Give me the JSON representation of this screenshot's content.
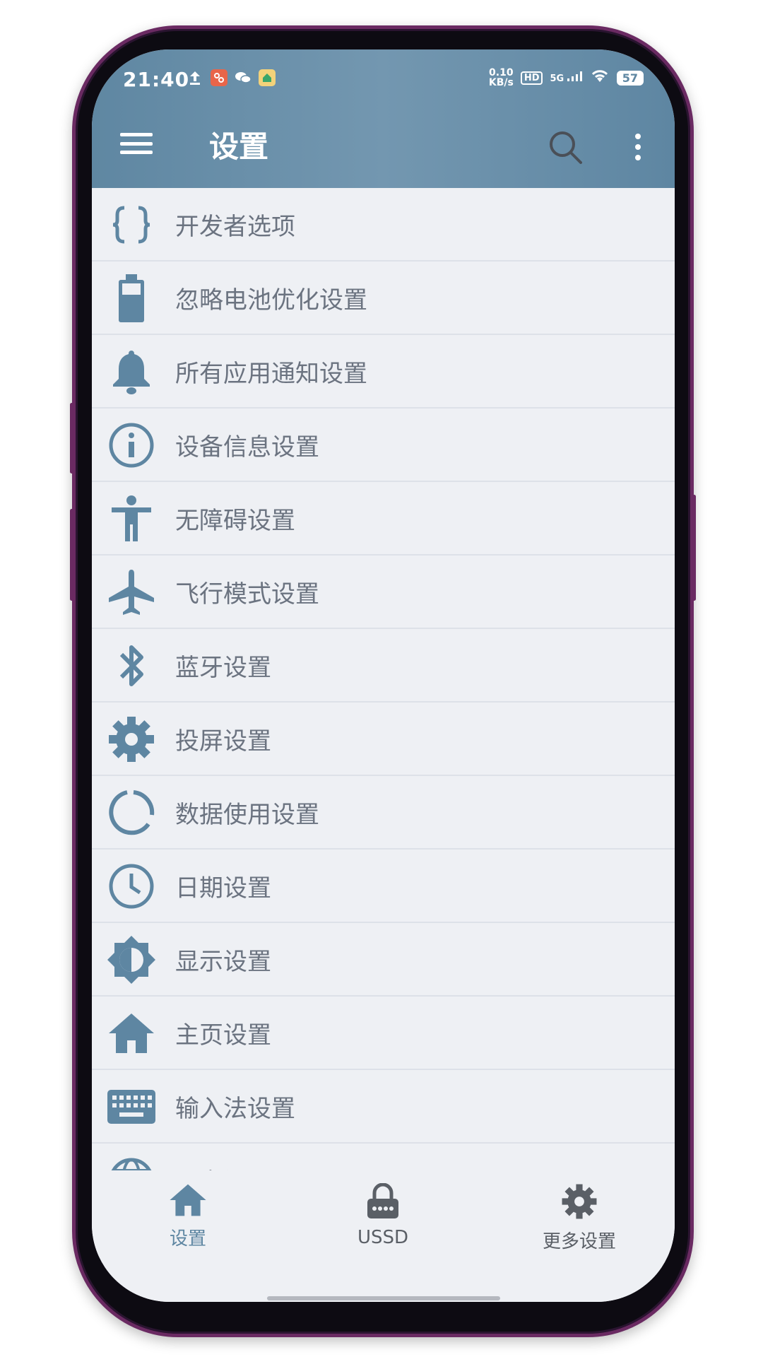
{
  "status_bar": {
    "time": "21:40",
    "net_speed_value": "0.10",
    "net_speed_unit": "KB/s",
    "hd": "HD",
    "network": "5G",
    "battery": "57"
  },
  "app_bar": {
    "title": "设置"
  },
  "settings_items": [
    {
      "label": "开发者选项",
      "icon": "code-braces-icon"
    },
    {
      "label": "忽略电池优化设置",
      "icon": "battery-icon"
    },
    {
      "label": "所有应用通知设置",
      "icon": "bell-icon"
    },
    {
      "label": "设备信息设置",
      "icon": "info-icon"
    },
    {
      "label": "无障碍设置",
      "icon": "accessibility-icon"
    },
    {
      "label": "飞行模式设置",
      "icon": "airplane-icon"
    },
    {
      "label": "蓝牙设置",
      "icon": "bluetooth-icon"
    },
    {
      "label": "投屏设置",
      "icon": "gear-icon"
    },
    {
      "label": "数据使用设置",
      "icon": "data-usage-icon"
    },
    {
      "label": "日期设置",
      "icon": "clock-icon"
    },
    {
      "label": "显示设置",
      "icon": "brightness-icon"
    },
    {
      "label": "主页设置",
      "icon": "home-icon"
    },
    {
      "label": "输入法设置",
      "icon": "keyboard-icon"
    },
    {
      "label": "语言设置",
      "icon": "globe-icon"
    }
  ],
  "bottom_nav": [
    {
      "label": "设置",
      "icon": "home-icon",
      "active": true
    },
    {
      "label": "USSD",
      "icon": "lock-icon",
      "active": false
    },
    {
      "label": "更多设置",
      "icon": "gear-icon",
      "active": false
    }
  ],
  "colors": {
    "accent": "#5e86a2",
    "appbar": "#6a8fa9",
    "background": "#eef0f4",
    "text": "#6b7380",
    "nav_inactive": "#5a5f66"
  }
}
